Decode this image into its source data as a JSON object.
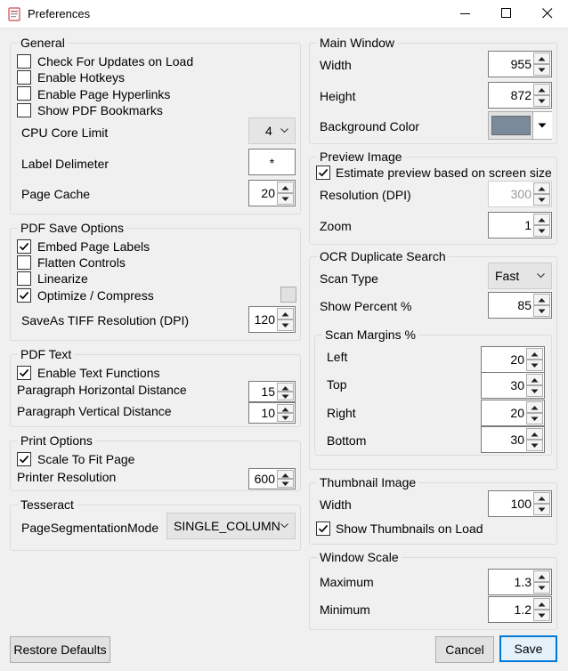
{
  "window": {
    "title": "Preferences"
  },
  "general": {
    "title": "General",
    "checks": [
      {
        "label": "Check For Updates on Load",
        "checked": false
      },
      {
        "label": "Enable Hotkeys",
        "checked": false
      },
      {
        "label": "Enable Page Hyperlinks",
        "checked": false
      },
      {
        "label": "Show PDF Bookmarks",
        "checked": false
      }
    ],
    "cpu_core_limit": {
      "label": "CPU Core Limit",
      "value": "4"
    },
    "label_delimeter": {
      "label": "Label Delimeter",
      "value": "*"
    },
    "page_cache": {
      "label": "Page Cache",
      "value": "20"
    }
  },
  "pdf_save": {
    "title": "PDF Save Options",
    "checks": [
      {
        "label": "Embed Page Labels",
        "checked": true
      },
      {
        "label": "Flatten Controls",
        "checked": false
      },
      {
        "label": "Linearize",
        "checked": false
      },
      {
        "label": "Optimize / Compress",
        "checked": true
      }
    ],
    "tiff_resolution": {
      "label": "SaveAs TIFF Resolution (DPI)",
      "value": "120"
    }
  },
  "pdf_text": {
    "title": "PDF Text",
    "enable": {
      "label": "Enable Text Functions",
      "checked": true
    },
    "horizontal": {
      "label": "Paragraph Horizontal Distance",
      "value": "15"
    },
    "vertical": {
      "label": "Paragraph Vertical Distance",
      "value": "10"
    }
  },
  "print": {
    "title": "Print Options",
    "scale": {
      "label": "Scale To Fit Page",
      "checked": true
    },
    "resolution": {
      "label": "Printer Resolution",
      "value": "600"
    }
  },
  "tesseract": {
    "title": "Tesseract",
    "mode": {
      "label": "PageSegmentationMode",
      "value": "SINGLE_COLUMN"
    }
  },
  "main_window": {
    "title": "Main Window",
    "width": {
      "label": "Width",
      "value": "955"
    },
    "height": {
      "label": "Height",
      "value": "872"
    },
    "background": {
      "label": "Background Color",
      "color": "#7a8a9b"
    }
  },
  "preview": {
    "title": "Preview Image",
    "estimate": {
      "label": "Estimate preview based on screen size",
      "checked": true
    },
    "resolution": {
      "label": "Resolution (DPI)",
      "value": "300"
    },
    "zoom": {
      "label": "Zoom",
      "value": "1"
    }
  },
  "ocr": {
    "title": "OCR Duplicate Search",
    "scan_type": {
      "label": "Scan Type",
      "value": "Fast"
    },
    "show_percent": {
      "label": "Show Percent %",
      "value": "85"
    },
    "margins": {
      "title": "Scan Margins %",
      "left": {
        "label": "Left",
        "value": "20"
      },
      "top": {
        "label": "Top",
        "value": "30"
      },
      "right": {
        "label": "Right",
        "value": "20"
      },
      "bottom": {
        "label": "Bottom",
        "value": "30"
      }
    }
  },
  "thumbnail": {
    "title": "Thumbnail Image",
    "width": {
      "label": "Width",
      "value": "100"
    },
    "show": {
      "label": "Show Thumbnails on Load",
      "checked": true
    }
  },
  "scale": {
    "title": "Window Scale",
    "maximum": {
      "label": "Maximum",
      "value": "1.3"
    },
    "minimum": {
      "label": "Minimum",
      "value": "1.2"
    }
  },
  "buttons": {
    "restore": "Restore Defaults",
    "cancel": "Cancel",
    "save": "Save"
  },
  "colors": {
    "accent": "#0078d7",
    "window_bg": "#f0f0f0"
  }
}
